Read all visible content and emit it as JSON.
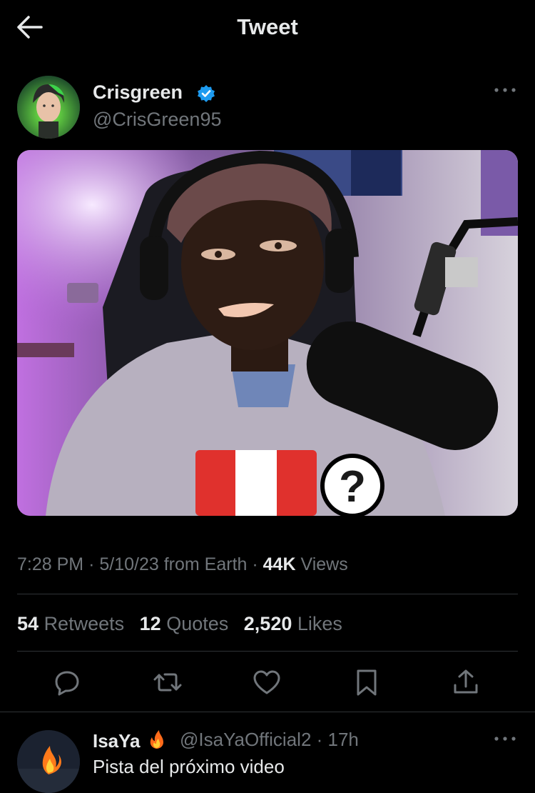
{
  "header": {
    "title": "Tweet"
  },
  "tweet": {
    "author_name": "Crisgreen",
    "author_handle": "@CrisGreen95",
    "time": "7:28 PM",
    "date": "5/10/23",
    "source": "from Earth",
    "views_count": "44K",
    "views_label": "Views",
    "stats": {
      "retweets_count": "54",
      "retweets_label": "Retweets",
      "quotes_count": "12",
      "quotes_label": "Quotes",
      "likes_count": "2,520",
      "likes_label": "Likes"
    }
  },
  "reply": {
    "author_name": "IsaYa",
    "author_handle": "@IsaYaOfficial2",
    "time": "17h",
    "text": "Pista del próximo video"
  },
  "icons": {
    "back": "arrow-left-icon",
    "verified": "verified-badge-icon",
    "more": "more-icon",
    "reply": "reply-icon",
    "retweet": "retweet-icon",
    "like": "heart-icon",
    "bookmark": "bookmark-icon",
    "share": "share-icon"
  },
  "colors": {
    "background": "#000000",
    "text": "#e7e9ea",
    "secondary": "#71767b",
    "verified": "#1d9bf0",
    "divider": "#2f3336"
  }
}
